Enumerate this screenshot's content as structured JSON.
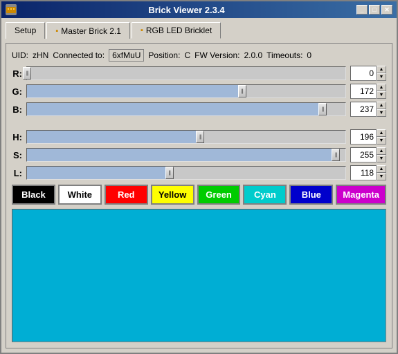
{
  "window": {
    "title": "Brick Viewer 2.3.4",
    "icon": "brick-icon"
  },
  "titlebar": {
    "minimize_label": "_",
    "maximize_label": "□",
    "close_label": "✕"
  },
  "tabs": [
    {
      "id": "setup",
      "label": "Setup",
      "active": false
    },
    {
      "id": "master-brick",
      "label": "Master Brick 2.1",
      "active": false,
      "icon": "brick-tab-icon"
    },
    {
      "id": "rgb-led",
      "label": "RGB LED Bricklet",
      "active": true,
      "icon": "bricklet-tab-icon"
    }
  ],
  "info": {
    "uid_label": "UID:",
    "uid_value": "zHN",
    "connected_label": "Connected to:",
    "connected_value": "6xfMuU",
    "position_label": "Position:",
    "position_value": "C",
    "fw_label": "FW Version:",
    "fw_value": "2.0.0",
    "timeouts_label": "Timeouts:",
    "timeouts_value": "0"
  },
  "sliders": [
    {
      "label": "R:",
      "value": 0,
      "max": 255,
      "percent": 0
    },
    {
      "label": "G:",
      "value": 172,
      "max": 255,
      "percent": 67.5
    },
    {
      "label": "B:",
      "value": 237,
      "max": 255,
      "percent": 92.9
    }
  ],
  "hsl_sliders": [
    {
      "label": "H:",
      "value": 196,
      "max": 360,
      "percent": 54.4
    },
    {
      "label": "S:",
      "value": 255,
      "max": 255,
      "percent": 97.0
    },
    {
      "label": "L:",
      "value": 118,
      "max": 255,
      "percent": 44.7
    }
  ],
  "color_buttons": [
    {
      "id": "black",
      "label": "Black",
      "bg": "#000000",
      "text": "white"
    },
    {
      "id": "white",
      "label": "White",
      "bg": "#ffffff",
      "text": "black"
    },
    {
      "id": "red",
      "label": "Red",
      "bg": "#ff0000",
      "text": "white"
    },
    {
      "id": "yellow",
      "label": "Yellow",
      "bg": "#ffff00",
      "text": "black"
    },
    {
      "id": "green",
      "label": "Green",
      "bg": "#00cc00",
      "text": "white"
    },
    {
      "id": "cyan",
      "label": "Cyan",
      "bg": "#00cccc",
      "text": "white"
    },
    {
      "id": "blue",
      "label": "Blue",
      "bg": "#0000cc",
      "text": "white"
    },
    {
      "id": "magenta",
      "label": "Magenta",
      "bg": "#cc00cc",
      "text": "white"
    }
  ],
  "preview": {
    "color": "#00aed4"
  }
}
